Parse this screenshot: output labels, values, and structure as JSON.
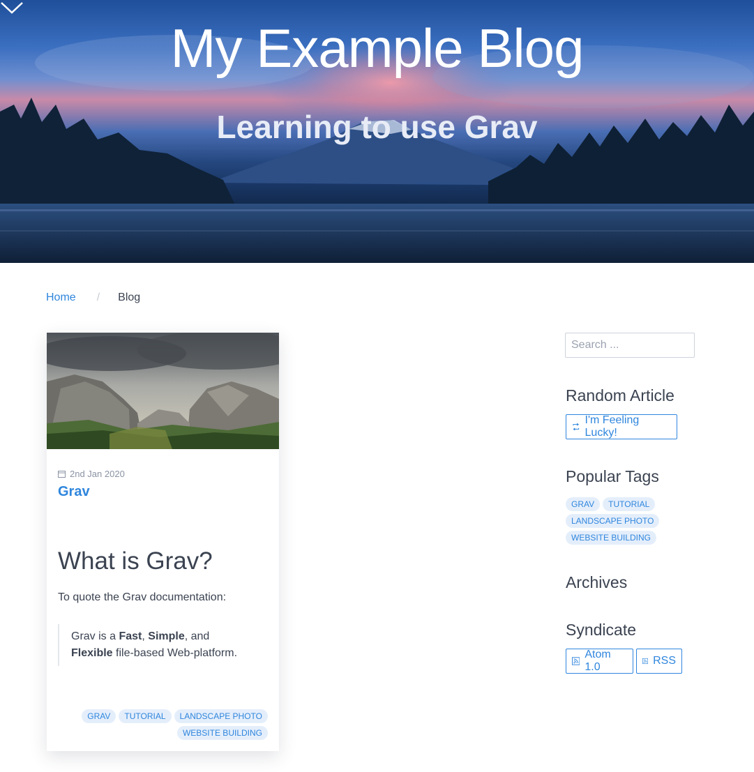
{
  "hero": {
    "title": "My Example Blog",
    "subtitle": "Learning to use Grav",
    "scroll_icon": "chevron-down-icon"
  },
  "breadcrumb": {
    "home": "Home",
    "separator": "/",
    "current": "Blog"
  },
  "post": {
    "date": "2nd Jan 2020",
    "date_icon": "calendar-icon",
    "title": "Grav",
    "heading": "What is Grav?",
    "intro": "To quote the Grav documentation:",
    "quote": {
      "prefix": "Grav is a ",
      "word1": "Fast",
      "sep1": ", ",
      "word2": "Simple",
      "sep2": ", and ",
      "word3": "Flexible",
      "suffix": " file-based Web-platform."
    },
    "tags": [
      "GRAV",
      "TUTORIAL",
      "LANDSCAPE PHOTO",
      "WEBSITE BUILDING"
    ]
  },
  "sidebar": {
    "search_placeholder": "Search ...",
    "random_heading": "Random Article",
    "random_button": "I'm Feeling Lucky!",
    "random_icon": "shuffle-icon",
    "tags_heading": "Popular Tags",
    "tags": [
      "GRAV",
      "TUTORIAL",
      "LANDSCAPE PHOTO",
      "WEBSITE BUILDING"
    ],
    "archives_heading": "Archives",
    "syndicate_heading": "Syndicate",
    "atom_button": "Atom 1.0",
    "rss_button": "RSS",
    "feed_icon": "rss-icon"
  },
  "colors": {
    "accent": "#2f86dd",
    "text": "#3b4351",
    "chip_bg": "#e4eefb"
  }
}
